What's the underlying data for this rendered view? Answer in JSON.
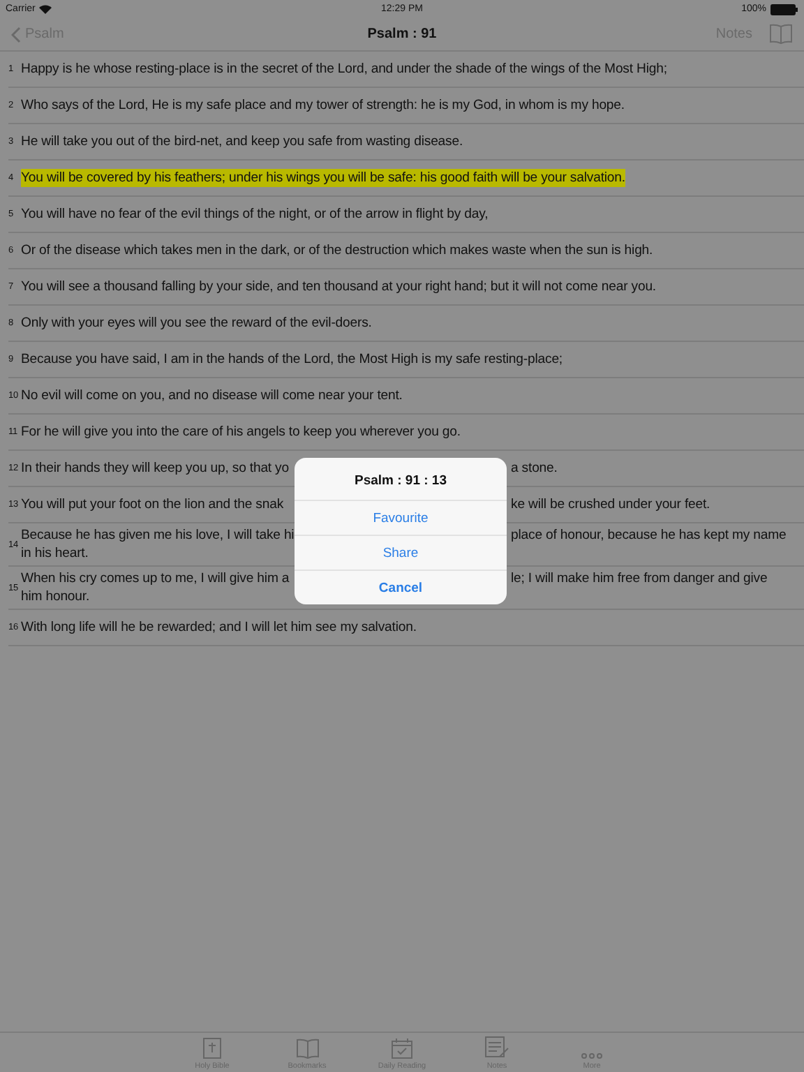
{
  "status_bar": {
    "carrier": "Carrier",
    "time": "12:29 PM",
    "battery": "100%"
  },
  "nav": {
    "back": "Psalm",
    "title": "Psalm : 91",
    "notes": "Notes"
  },
  "verses": [
    {
      "number": "1",
      "kind": "plain",
      "highlighted": false,
      "text": "Happy is he whose resting-place is in the secret of the Lord, and under the shade of the wings of the Most High;"
    },
    {
      "number": "2",
      "kind": "plain",
      "highlighted": false,
      "text": "Who says of the Lord, He is my safe place and my tower of strength: he is my God, in whom is my hope."
    },
    {
      "number": "3",
      "kind": "plain",
      "highlighted": false,
      "text": "He will take you out of the bird-net, and keep you safe from wasting disease."
    },
    {
      "number": "4",
      "kind": "plain",
      "highlighted": true,
      "text": "You will be covered by his feathers; under his wings you will be safe: his good faith will be your salvation."
    },
    {
      "number": "5",
      "kind": "plain",
      "highlighted": false,
      "text": "You will have no fear of the evil things of the night, or of the arrow in flight by day,"
    },
    {
      "number": "6",
      "kind": "plain",
      "highlighted": false,
      "text": "Or of the disease which takes men in the dark, or of the destruction which makes waste when the sun is high."
    },
    {
      "number": "7",
      "kind": "plain",
      "highlighted": false,
      "text": "You will see a thousand falling by your side, and ten thousand at your right hand; but it will not come near you."
    },
    {
      "number": "8",
      "kind": "plain",
      "highlighted": false,
      "text": "Only with your eyes will you see the reward of the evil-doers."
    },
    {
      "number": "9",
      "kind": "plain",
      "highlighted": false,
      "text": "Because you have said, I am in the hands of the Lord, the Most High is my safe resting-place;"
    },
    {
      "number": "10",
      "kind": "plain",
      "highlighted": false,
      "text": "No evil will come on you, and no disease will come near your tent."
    },
    {
      "number": "11",
      "kind": "plain",
      "highlighted": false,
      "text": "For he will give you into the care of his angels to keep you wherever you go."
    },
    {
      "number": "12",
      "kind": "split",
      "highlighted": false,
      "lines": [
        {
          "left": "In their hands they will keep you up, so that yo",
          "right": "a stone."
        }
      ]
    },
    {
      "number": "13",
      "kind": "split",
      "highlighted": false,
      "lines": [
        {
          "left": "You will put your foot on the lion and the snak",
          "right": "ke will be crushed under your feet."
        }
      ]
    },
    {
      "number": "14",
      "kind": "split",
      "highlighted": false,
      "lines": [
        {
          "left": "Because he has given me his love, I will take hi",
          "right": "place of honour, because he has kept my name"
        },
        {
          "left": "in his heart."
        }
      ]
    },
    {
      "number": "15",
      "kind": "split",
      "highlighted": false,
      "lines": [
        {
          "left": "When his cry comes up to me, I will give him a",
          "right": "le; I will make him free from danger and give"
        },
        {
          "left": "him honour."
        }
      ]
    },
    {
      "number": "16",
      "kind": "plain",
      "highlighted": false,
      "text": "With long life will he be rewarded; and I will let him see my salvation."
    }
  ],
  "dialog": {
    "title": "Psalm : 91 : 13",
    "actions": [
      {
        "label": "Favourite",
        "kind": "normal"
      },
      {
        "label": "Share",
        "kind": "normal"
      },
      {
        "label": "Cancel",
        "kind": "cancel"
      }
    ]
  },
  "tab_bar": [
    {
      "label": "Holy Bible",
      "kind": "bible"
    },
    {
      "label": "Bookmarks",
      "kind": "book"
    },
    {
      "label": "Daily Reading",
      "kind": "calendar"
    },
    {
      "label": "Notes",
      "kind": "notes"
    },
    {
      "label": "More",
      "kind": "more"
    }
  ]
}
